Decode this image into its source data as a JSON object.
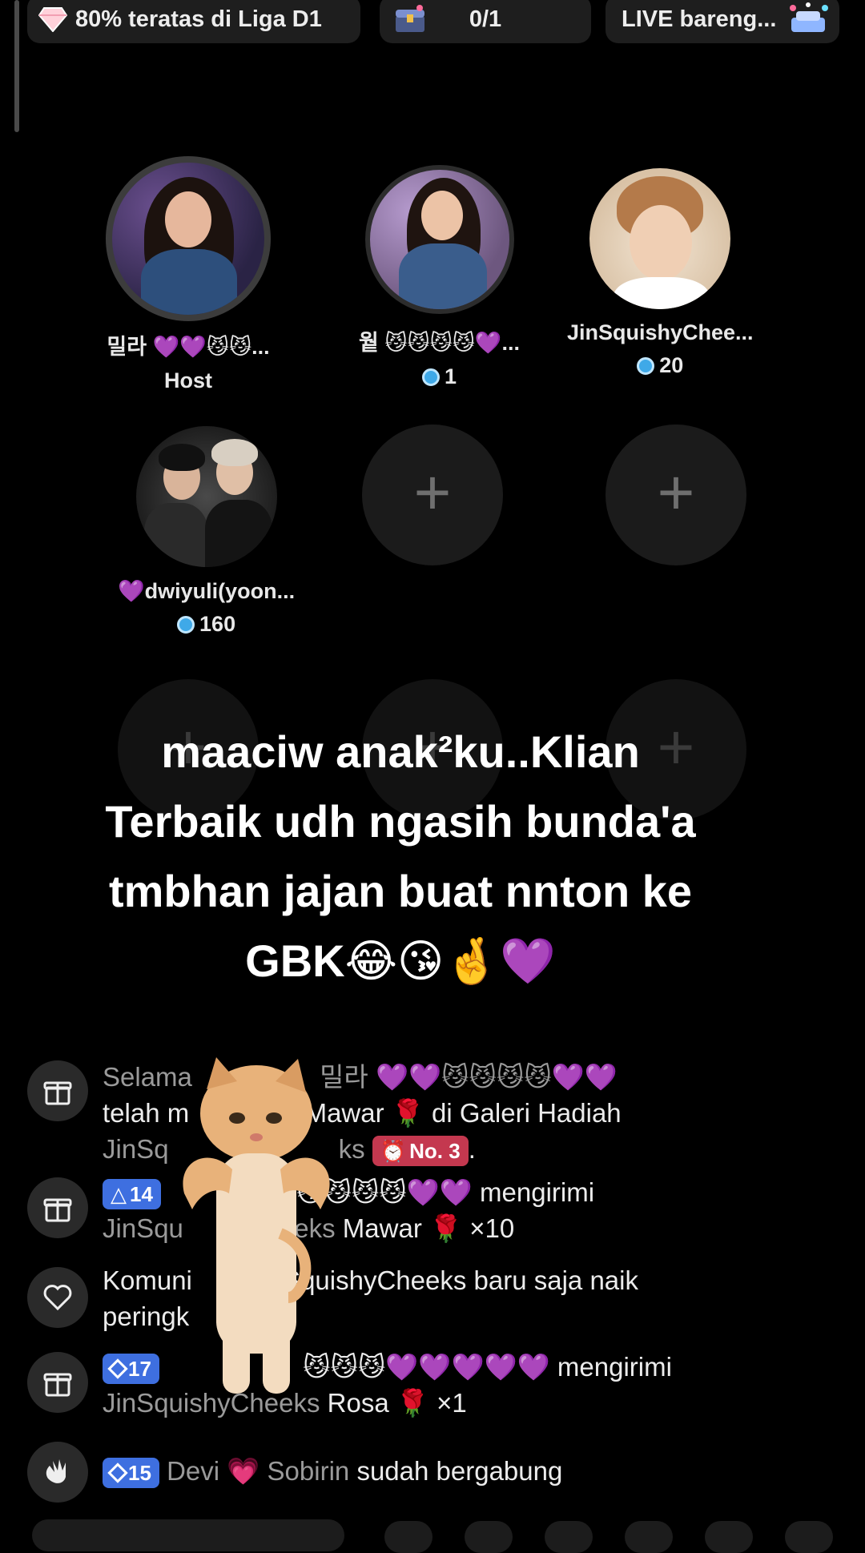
{
  "top_bar": {
    "league_label": "80% teratas di Liga D1",
    "task_count": "0/1",
    "live_label": "LIVE bareng..."
  },
  "seats": [
    {
      "name": "밀라 💜💜😼😼...",
      "sub": "Host"
    },
    {
      "name": "웥 😼😼😼😼💜...",
      "sub": "1"
    },
    {
      "name": "JinSquishyChee...",
      "sub": "20"
    },
    {
      "name": "💜dwiyuli(yoon...",
      "sub": "160"
    }
  ],
  "caption": {
    "line1": "maaciw anak²ku..Klian",
    "line2": "Terbaik udh ngasih bunda'a",
    "line3": "tmbhan jajan buat nnton ke",
    "line4": "GBK😂😘🤞💜"
  },
  "chat": {
    "msg1": {
      "a": "Selama",
      "b": "밀라 💜💜😼😼😼😼💜💜",
      "c": "telah m",
      "d": "kan Mawar 🌹 di Galeri Hadiah",
      "e": "JinSq",
      "f": "ks",
      "badge": "No. 3",
      "g": "."
    },
    "msg2": {
      "badge": "14",
      "a": "😼😼😼😼💜💜 mengirimi",
      "b": "JinSqu",
      "c": "eeks",
      "d": "Mawar 🌹 ×10"
    },
    "msg3": {
      "a": "Komuni",
      "b": "SquishyCheeks baru saja naik",
      "c": "peringk"
    },
    "msg4": {
      "badge": "17",
      "a": "😼😼😼💜💜💜💜💜 mengirimi",
      "b": "JinSquishyCheeks",
      "c": "Rosa 🌹 ×1"
    },
    "msg5": {
      "badge": "15",
      "a": "Devi 💗 Sobirin",
      "b": "sudah bergabung"
    }
  }
}
